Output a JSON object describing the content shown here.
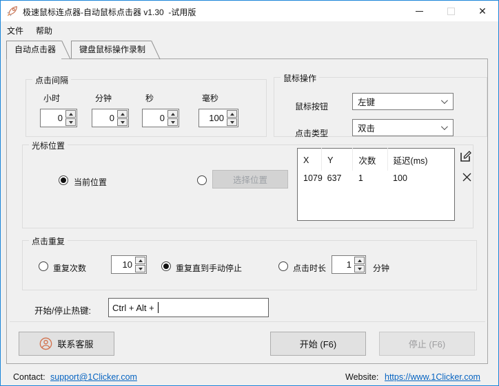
{
  "window": {
    "title": "极速鼠标连点器-自动鼠标点击器 v1.30  -试用版",
    "close_glyph": "✕"
  },
  "menu": {
    "items": [
      "文件",
      "帮助"
    ]
  },
  "tabs": [
    {
      "label": "自动点击器",
      "active": true
    },
    {
      "label": "键盘鼠标操作录制",
      "active": false
    }
  ],
  "click_interval": {
    "title": "点击间隔",
    "fields": [
      {
        "label": "小时",
        "value": "0"
      },
      {
        "label": "分钟",
        "value": "0"
      },
      {
        "label": "秒",
        "value": "0"
      },
      {
        "label": "毫秒",
        "value": "100"
      }
    ]
  },
  "mouse_action": {
    "title": "鼠标操作",
    "button_label": "鼠标按钮",
    "button_value": "左键",
    "type_label": "点击类型",
    "type_value": "双击"
  },
  "cursor_position": {
    "title": "光标位置",
    "current_label": "当前位置",
    "pick_button": "选择位置",
    "table": {
      "headers": [
        "X",
        "Y",
        "次数",
        "延迟(ms)"
      ],
      "rows": [
        [
          "1079",
          "637",
          "1",
          "100"
        ]
      ]
    }
  },
  "click_repeat": {
    "title": "点击重复",
    "times_label": "重复次数",
    "times_value": "10",
    "until_label": "重复直到手动停止",
    "duration_label": "点击时长",
    "duration_value": "1",
    "duration_unit": "分钟"
  },
  "hotkey": {
    "label": "开始/停止热键:",
    "value": "Ctrl + Alt + "
  },
  "actions": {
    "contact_button": "联系客服",
    "start_button": "开始 (F6)",
    "stop_button": "停止 (F6)"
  },
  "footer": {
    "contact_label": "Contact:",
    "contact_link": "support@1Clicker.com",
    "website_label": "Website:",
    "website_link": "https://www.1Clicker.com"
  },
  "icons": {
    "app": "rocket",
    "edit": "pencil-square",
    "delete": "x-mark",
    "contact": "person-circle",
    "combo": "chevron-down"
  },
  "colors": {
    "window_border": "#1a85d9",
    "link": "#0563c1",
    "icon_orange": "#d2714c",
    "window_bg": "#f0f0f0"
  }
}
